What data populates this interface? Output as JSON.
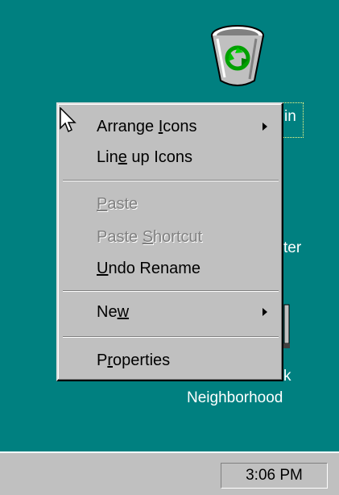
{
  "desktop": {
    "background": "#008080",
    "recycle_bin": {
      "label": "in",
      "icon": "recycle-bin-icon"
    },
    "my_computer": {
      "label": "ter"
    },
    "network_neighborhood": {
      "label_line1": "k",
      "label_line2": "Neighborhood"
    }
  },
  "context_menu": {
    "items": [
      {
        "label": "Arrange Icons",
        "mnemonic": "I",
        "enabled": true,
        "submenu": true
      },
      {
        "label": "Line up Icons",
        "mnemonic": "e",
        "enabled": true,
        "submenu": false
      },
      {
        "label": "Paste",
        "mnemonic": "P",
        "enabled": false,
        "submenu": false
      },
      {
        "label": "Paste Shortcut",
        "mnemonic": "S",
        "enabled": false,
        "submenu": false
      },
      {
        "label": "Undo Rename",
        "mnemonic": "U",
        "enabled": true,
        "submenu": false
      },
      {
        "label": "New",
        "mnemonic": "w",
        "enabled": true,
        "submenu": true
      },
      {
        "label": "Properties",
        "mnemonic": "r",
        "enabled": true,
        "submenu": false
      }
    ]
  },
  "taskbar": {
    "clock": "3:06 PM"
  }
}
